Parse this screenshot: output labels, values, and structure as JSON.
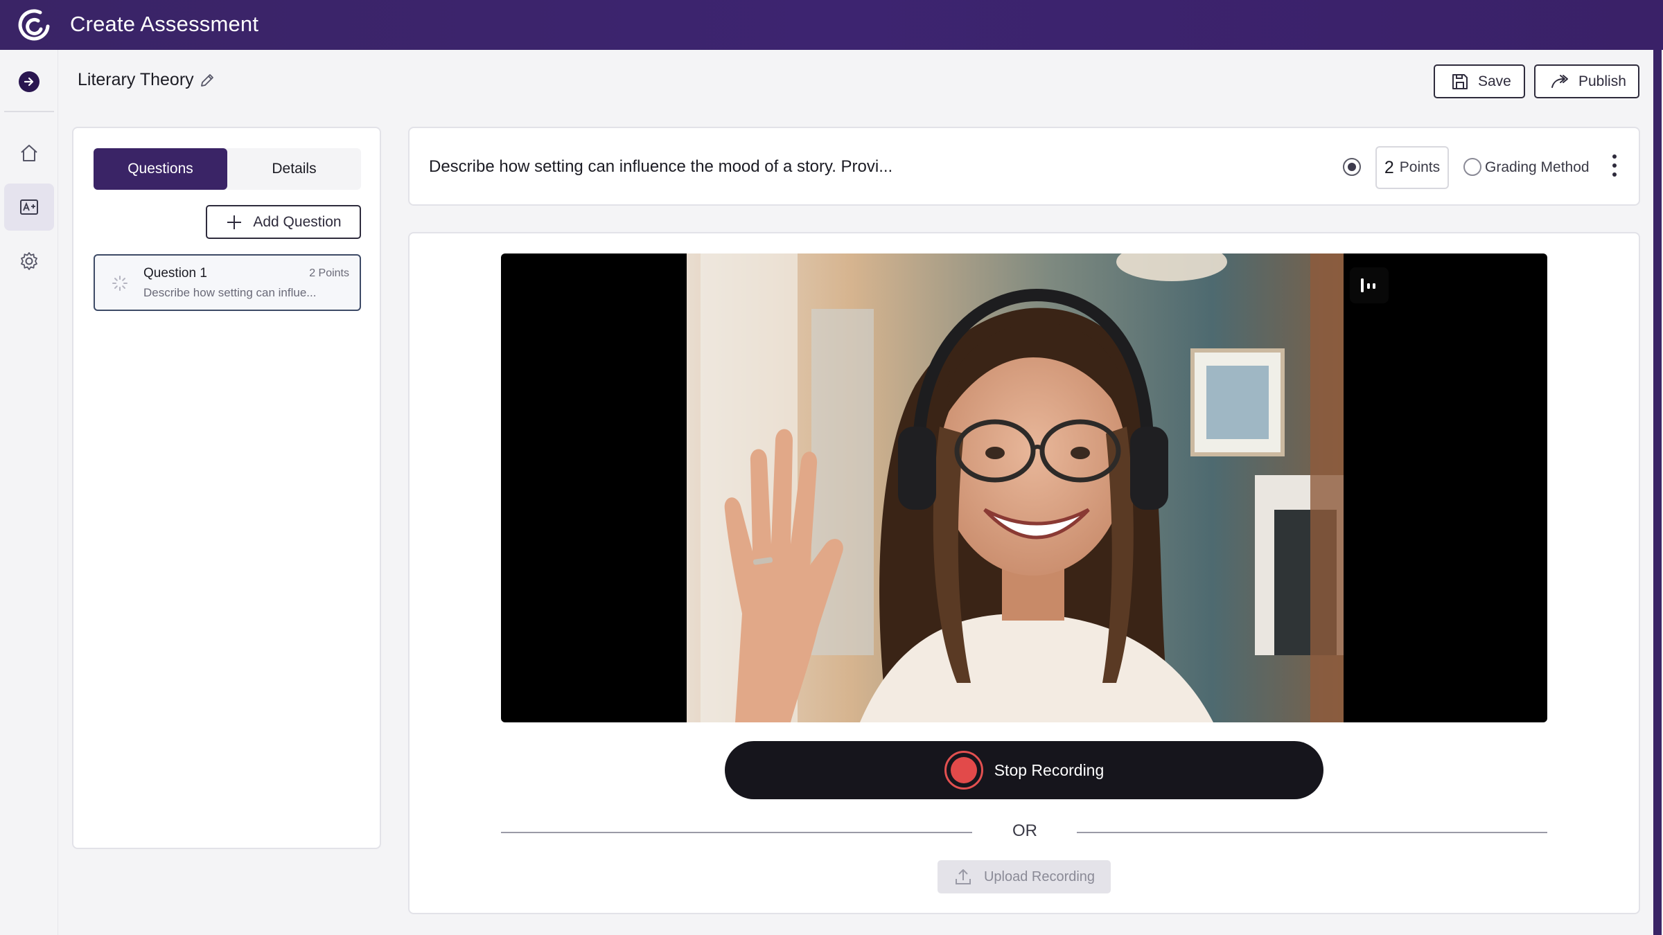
{
  "app": {
    "title": "Create Assessment"
  },
  "header": {
    "assessment_title": "Literary Theory",
    "save_label": "Save",
    "publish_label": "Publish"
  },
  "left_panel": {
    "tabs": [
      {
        "label": "Questions",
        "active": true
      },
      {
        "label": "Details",
        "active": false
      }
    ],
    "add_question_label": "Add Question",
    "questions": [
      {
        "title": "Question 1",
        "points": "2 Points",
        "description": "Describe how setting can influe..."
      }
    ]
  },
  "question": {
    "text": "Describe how setting can influence the mood of a story. Provi...",
    "points_value": "2",
    "points_unit": "Points",
    "points_selected": true,
    "grading_method_label": "Grading Method",
    "grading_method_selected": false
  },
  "recording": {
    "stop_label": "Stop Recording",
    "or_label": "OR",
    "upload_label": "Upload Recording"
  },
  "colors": {
    "brand": "#3a2466",
    "record": "#e24a4a",
    "dark_button": "#16151c"
  },
  "icons": [
    "logo-icon",
    "arrow-right-icon",
    "home-icon",
    "grade-icon",
    "gear-icon",
    "pencil-icon",
    "save-icon",
    "share-icon",
    "plus-icon",
    "spinner-icon",
    "kebab-icon",
    "pause-icon",
    "record-icon",
    "upload-icon"
  ]
}
